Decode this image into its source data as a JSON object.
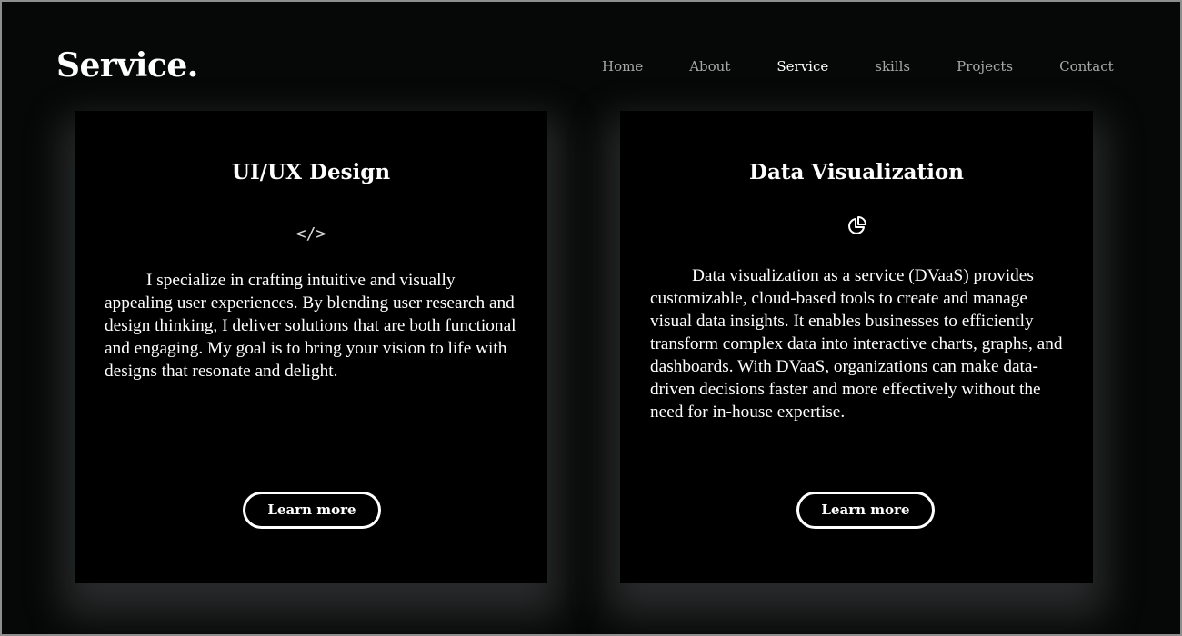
{
  "header": {
    "brand": "Service.",
    "nav": [
      {
        "label": "Home",
        "active": false
      },
      {
        "label": "About",
        "active": false
      },
      {
        "label": "Service",
        "active": true
      },
      {
        "label": "skills",
        "active": false
      },
      {
        "label": "Projects",
        "active": false
      },
      {
        "label": "Contact",
        "active": false
      }
    ]
  },
  "cards": [
    {
      "title": "UI/UX Design",
      "icon": "code-icon",
      "icon_glyph": "</>",
      "description": "I specialize in crafting intuitive and visually appealing user experiences. By blending user research and design thinking, I deliver solutions that are both functional and engaging. My goal is to bring your vision to life with designs that resonate and delight.",
      "button_label": "Learn more"
    },
    {
      "title": "Data Visualization",
      "icon": "pie-chart-icon",
      "description": "Data visualization as a service (DVaaS) provides customizable, cloud-based tools to create and manage visual data insights. It enables businesses to efficiently transform complex data into interactive charts, graphs, and dashboards. With DVaaS, organizations can make data-driven decisions faster and more effectively without the need for in-house expertise.",
      "button_label": "Learn more"
    }
  ],
  "colors": {
    "background": "#060707",
    "card": "#000000",
    "text": "#ffffff",
    "nav_inactive": "#a7a7a7"
  }
}
